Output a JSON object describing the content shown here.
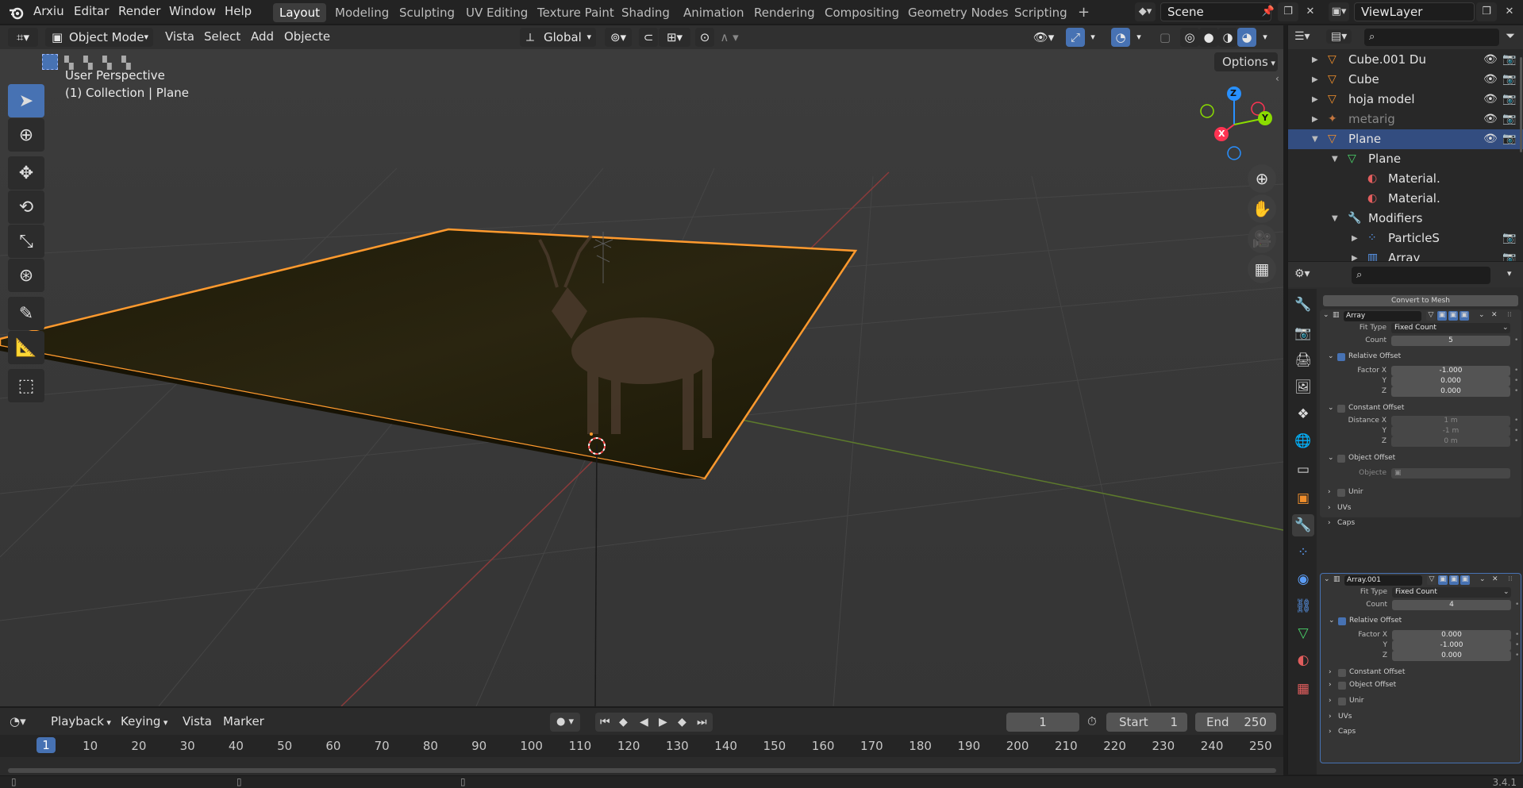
{
  "topbar": {
    "menus": [
      "Arxiu",
      "Editar",
      "Render",
      "Window",
      "Help"
    ],
    "workspaces": [
      "Layout",
      "Modeling",
      "Sculpting",
      "UV Editing",
      "Texture Paint",
      "Shading",
      "Animation",
      "Rendering",
      "Compositing",
      "Geometry Nodes",
      "Scripting"
    ],
    "active_workspace": "Layout",
    "add_tab": "+",
    "scene": "Scene",
    "view_layer": "ViewLayer"
  },
  "viewport_header": {
    "mode": "Object Mode",
    "menus": [
      "Vista",
      "Select",
      "Add",
      "Objecte"
    ],
    "orientation": "Global",
    "options": "Options"
  },
  "viewport": {
    "title": "User Perspective",
    "subtitle": "(1) Collection | Plane",
    "gizmo": {
      "x": "X",
      "y": "Y",
      "z": "Z"
    }
  },
  "timeline": {
    "menus": [
      "Playback",
      "Keying",
      "Vista",
      "Marker"
    ],
    "current_frame": "1",
    "start_label": "Start",
    "start": "1",
    "end_label": "End",
    "end": "250",
    "ticks": [
      "1",
      "10",
      "20",
      "30",
      "40",
      "50",
      "60",
      "70",
      "80",
      "90",
      "100",
      "110",
      "120",
      "130",
      "140",
      "150",
      "160",
      "170",
      "180",
      "190",
      "200",
      "210",
      "220",
      "230",
      "240",
      "250"
    ]
  },
  "status": {
    "version": "3.4.1"
  },
  "outliner": {
    "rows": [
      {
        "name": "Cube.001 Du",
        "indent": 1,
        "icon": "triangle"
      },
      {
        "name": "Cube",
        "indent": 1,
        "icon": "triangle"
      },
      {
        "name": "hoja model",
        "indent": 1,
        "icon": "triangle"
      },
      {
        "name": "metarig",
        "indent": 1,
        "icon": "armature"
      },
      {
        "name": "Plane",
        "indent": 1,
        "icon": "triangle",
        "selected": true
      },
      {
        "name": "Plane",
        "indent": 2,
        "icon": "mesh"
      },
      {
        "name": "Material.",
        "indent": 3,
        "icon": "material"
      },
      {
        "name": "Material.",
        "indent": 3,
        "icon": "material"
      },
      {
        "name": "Modifiers",
        "indent": 2,
        "icon": "wrench"
      },
      {
        "name": "ParticleS",
        "indent": 3,
        "icon": "particles"
      },
      {
        "name": "Array",
        "indent": 3,
        "icon": "array"
      }
    ]
  },
  "properties": {
    "convert_button": "Convert to Mesh",
    "modifiers": [
      {
        "name": "Array",
        "fit_type_label": "Fit Type",
        "fit_type": "Fixed Count",
        "count_label": "Count",
        "count": "5",
        "relative_offset": "Relative Offset",
        "factor_labels": [
          "Factor X",
          "Y",
          "Z"
        ],
        "factors": [
          "-1.000",
          "0.000",
          "0.000"
        ],
        "constant_offset": "Constant Offset",
        "distance_labels": [
          "Distance X",
          "Y",
          "Z"
        ],
        "distances": [
          "1 m",
          "-1 m",
          "0 m"
        ],
        "object_offset": "Object Offset",
        "object_label": "Objecte",
        "merge": "Unir",
        "uvs": "UVs",
        "caps": "Caps"
      },
      {
        "name": "Array.001",
        "fit_type_label": "Fit Type",
        "fit_type": "Fixed Count",
        "count_label": "Count",
        "count": "4",
        "relative_offset": "Relative Offset",
        "factor_labels": [
          "Factor X",
          "Y",
          "Z"
        ],
        "factors": [
          "0.000",
          "-1.000",
          "0.000"
        ],
        "constant_offset": "Constant Offset",
        "object_offset": "Object Offset",
        "merge": "Unir",
        "uvs": "UVs",
        "caps": "Caps"
      }
    ]
  },
  "colors": {
    "accent": "#4772b3",
    "selection": "#ff9a2e",
    "x_axis": "#ff3352",
    "y_axis": "#8bdc00",
    "z_axis": "#2890ff"
  }
}
